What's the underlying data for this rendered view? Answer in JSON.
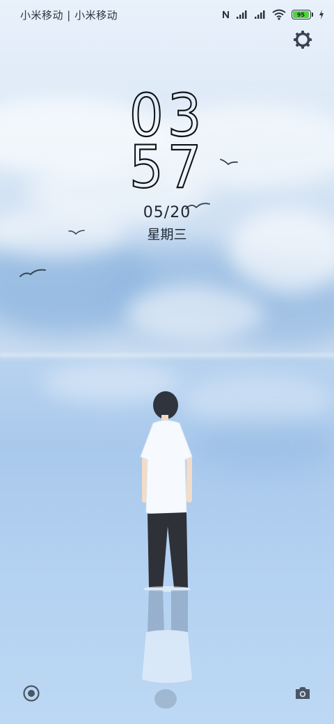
{
  "status_bar": {
    "carrier_text": "小米移动 | 小米移动",
    "battery_level": "95",
    "icons": [
      "nfc-icon",
      "signal-icon-sim1",
      "signal-icon-sim2",
      "wifi-icon",
      "battery-icon",
      "charging-icon"
    ]
  },
  "lock_screen": {
    "hour": "03",
    "minute": "57",
    "date": "05/20",
    "weekday": "星期三"
  },
  "controls": {
    "top_right_icon": "gear-icon",
    "bottom_left_icon": "record-icon",
    "bottom_right_icon": "camera-icon"
  },
  "colors": {
    "battery_fill": "#4cd53a",
    "text": "#0f1216",
    "sky_top": "#e9f1fb",
    "water": "#a9c9ec"
  }
}
